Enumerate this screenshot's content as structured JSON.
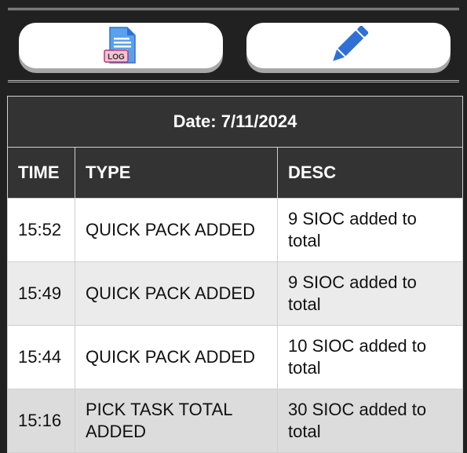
{
  "toolbar": {
    "log_button": {
      "icon": "log-file-icon",
      "icon_text": "LOG"
    },
    "edit_button": {
      "icon": "pencil-icon"
    }
  },
  "colors": {
    "background": "#212121",
    "header_bg": "#333333",
    "icon_blue": "#2f6fd6",
    "row_alt": "#ebebeb",
    "row_selected": "#dcdcdc"
  },
  "log_table": {
    "date_label": "Date: 7/11/2024",
    "columns": [
      "TIME",
      "TYPE",
      "DESC"
    ],
    "rows": [
      {
        "time": "15:52",
        "type": "QUICK PACK ADDED",
        "desc": "9 SIOC added to total"
      },
      {
        "time": "15:49",
        "type": "QUICK PACK ADDED",
        "desc": "9 SIOC added to total"
      },
      {
        "time": "15:44",
        "type": "QUICK PACK ADDED",
        "desc": "10 SIOC added to total"
      },
      {
        "time": "15:16",
        "type": "PICK TASK TOTAL ADDED",
        "desc": "30 SIOC added to total"
      }
    ]
  }
}
